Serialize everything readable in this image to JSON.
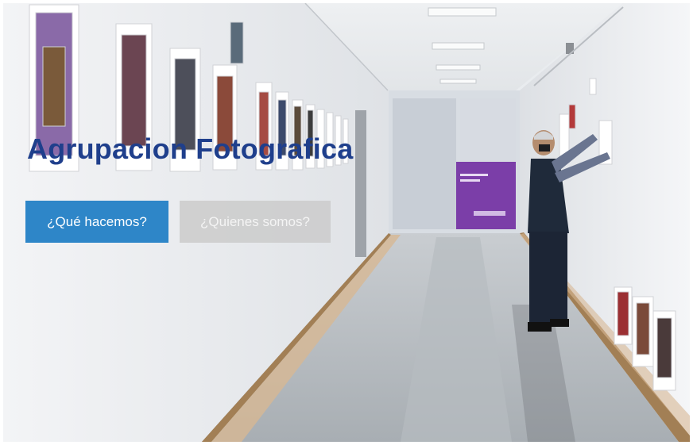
{
  "hero": {
    "title": "Agrupacion Fotografica",
    "background_image": "gallery-corridor-photo",
    "buttons": [
      {
        "label": "¿Qué hacemos?",
        "style": "primary"
      },
      {
        "label": "¿Quienes somos?",
        "style": "secondary"
      }
    ]
  },
  "colors": {
    "title": "#1f3f8c",
    "primary_button": "#2e86c8",
    "secondary_button": "#cdcdcd"
  }
}
